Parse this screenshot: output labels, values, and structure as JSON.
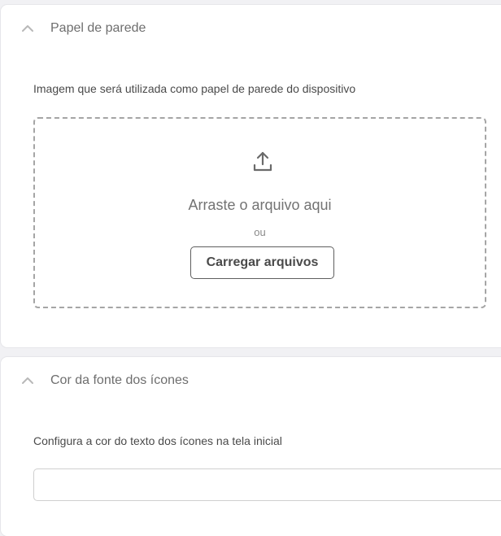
{
  "panels": [
    {
      "title": "Papel de parede",
      "description": "Imagem que será utilizada como papel de parede do dispositivo",
      "collapse_icon": "chevron-up-icon",
      "dropzone": {
        "icon": "upload-icon",
        "drop_text": "Arraste o arquivo aqui",
        "or_text": "ou",
        "button_label": "Carregar arquivos"
      }
    },
    {
      "title": "Cor da fonte dos ícones",
      "description": "Configura a cor do texto dos ícones na tela inicial",
      "collapse_icon": "chevron-up-icon",
      "input": {
        "value": "",
        "placeholder": ""
      }
    }
  ],
  "colors": {
    "page_background": "#f1f1f4",
    "panel_background": "#ffffff",
    "dashed_border": "#a5a5a5",
    "text": "#4a4a4a"
  }
}
